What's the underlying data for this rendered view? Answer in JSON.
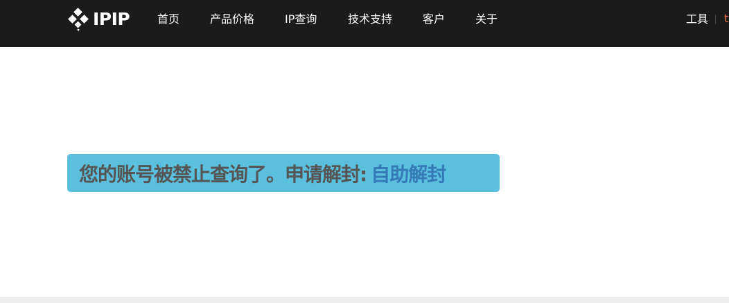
{
  "header": {
    "logo_text": "IPIP",
    "nav": [
      {
        "label": "首页"
      },
      {
        "label": "产品价格"
      },
      {
        "label": "IP查询"
      },
      {
        "label": "技术支持"
      },
      {
        "label": "客户"
      },
      {
        "label": "关于"
      }
    ],
    "tools_label": "工具",
    "clipped_text": "t"
  },
  "alert": {
    "message": "您的账号被禁止查询了。申请解封:",
    "link_label": "自助解封"
  },
  "colors": {
    "header_bg": "#1b1b1b",
    "alert_bg": "#5bc0de",
    "alert_text": "#555555",
    "link": "#337ab7",
    "accent": "#e8734a"
  }
}
